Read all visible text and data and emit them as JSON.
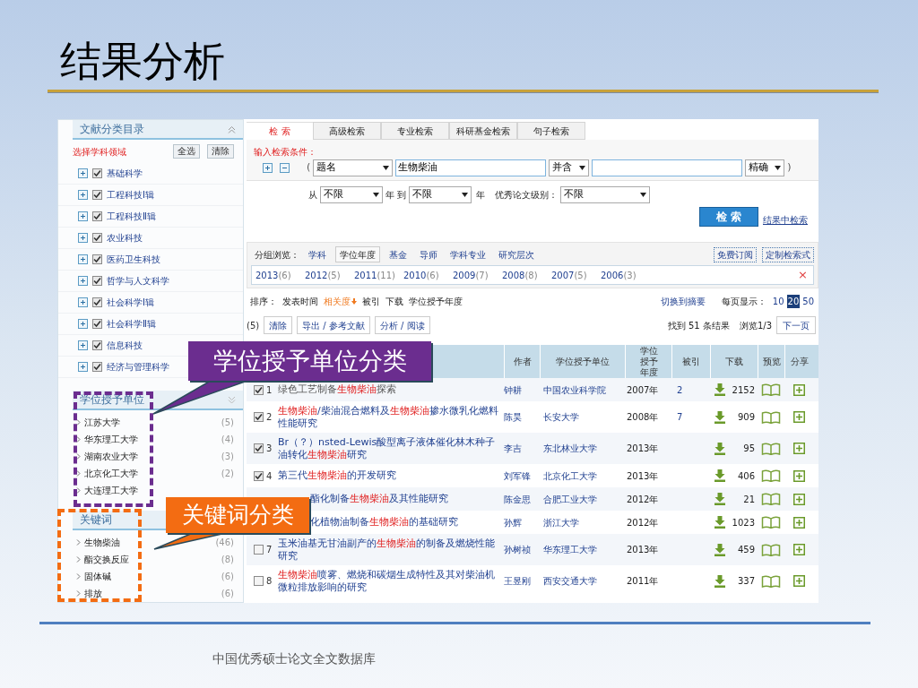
{
  "slide": {
    "title": "结果分析",
    "footer": "中国优秀硕士论文全文数据库"
  },
  "sidebar": {
    "heading": "文献分类目录",
    "field_label": "选择学科领域",
    "buttons": [
      "全选",
      "清除"
    ],
    "items": [
      {
        "label": "基础科学",
        "checked": true
      },
      {
        "label": "工程科技Ⅰ辑",
        "checked": true
      },
      {
        "label": "工程科技Ⅱ辑",
        "checked": true
      },
      {
        "label": "农业科技",
        "checked": true
      },
      {
        "label": "医药卫生科技",
        "checked": true
      },
      {
        "label": "哲学与人文科学",
        "checked": true
      },
      {
        "label": "社会科学Ⅰ辑",
        "checked": true
      },
      {
        "label": "社会科学Ⅱ辑",
        "checked": true
      },
      {
        "label": "信息科技",
        "checked": true
      },
      {
        "label": "经济与管理科学",
        "checked": true
      }
    ],
    "facets": [
      {
        "heading": "学位授予单位",
        "items": [
          {
            "label": "江苏大学",
            "count": "(5)"
          },
          {
            "label": "华东理工大学",
            "count": "(4)"
          },
          {
            "label": "湖南农业大学",
            "count": "(3)"
          },
          {
            "label": "北京化工大学",
            "count": "(2)"
          },
          {
            "label": "大连理工大学"
          }
        ]
      },
      {
        "heading": "关键词",
        "items": [
          {
            "label": "生物柴油",
            "count": "(46)"
          },
          {
            "label": "酯交换反应",
            "count": "(8)"
          },
          {
            "label": "固体碱",
            "count": "(6)"
          },
          {
            "label": "排放",
            "count": "(6)"
          }
        ]
      }
    ]
  },
  "search": {
    "tabs": [
      {
        "label": "检 索",
        "selected": true
      },
      {
        "label": "高级检索",
        "selected": false
      },
      {
        "label": "专业检索",
        "selected": false
      },
      {
        "label": "科研基金检索",
        "selected": false
      },
      {
        "label": "句子检索",
        "selected": false
      }
    ],
    "prompt": "输入检索条件：",
    "open_paren": "(",
    "field": "题名",
    "value": "生物柴油",
    "operator": "并含",
    "match": "精确",
    "close_paren": ")",
    "from_label": "从",
    "from": "不限",
    "to_label": "年 到",
    "to": "不限",
    "year_label": "年",
    "level_label": "优秀论文级别：",
    "level": "不限",
    "submit": "检 索",
    "refine_link": "结果中检索"
  },
  "grouping": {
    "label": "分组浏览：",
    "tabs": [
      {
        "label": "学科",
        "selected": false
      },
      {
        "label": "学位年度",
        "selected": true
      },
      {
        "label": "基金",
        "selected": false
      },
      {
        "label": "导师",
        "selected": false
      },
      {
        "label": "学科专业",
        "selected": false
      },
      {
        "label": "研究层次",
        "selected": false
      }
    ],
    "links": [
      "免费订阅",
      "定制检索式"
    ],
    "years": [
      {
        "year": "2013",
        "count": "(6)"
      },
      {
        "year": "2012",
        "count": "(5)"
      },
      {
        "year": "2011",
        "count": "(11)"
      },
      {
        "year": "2010",
        "count": "(6)"
      },
      {
        "year": "2009",
        "count": "(7)"
      },
      {
        "year": "2008",
        "count": "(8)"
      },
      {
        "year": "2007",
        "count": "(5)"
      },
      {
        "year": "2006",
        "count": "(3)"
      }
    ],
    "close": "×"
  },
  "sort": {
    "label": "排序：",
    "options": [
      {
        "label": "发表时间",
        "selected": false
      },
      {
        "label": "相关度",
        "selected": true
      },
      {
        "label": "被引",
        "selected": false
      },
      {
        "label": "下载",
        "selected": false
      },
      {
        "label": "学位授予年度",
        "selected": false
      }
    ],
    "abstract_link": "切换到摘要",
    "per_page_label": "每页显示：",
    "per_page": [
      {
        "label": "10",
        "selected": false
      },
      {
        "label": "20",
        "selected": true
      },
      {
        "label": "50",
        "selected": false
      }
    ]
  },
  "toolbar": {
    "selected_count": "(5)",
    "buttons": [
      "清除",
      "导出 / 参考文献",
      "分析 / 阅读"
    ],
    "found": "找到 51 条结果",
    "page": "浏览1/3",
    "next": "下一页"
  },
  "table": {
    "columns": [
      "作者",
      "学位授予单位",
      "学位授予年度",
      "被引",
      "下载",
      "预览",
      "分享"
    ],
    "rows": [
      {
        "covered": false,
        "checked": true,
        "number": "1",
        "visited": true,
        "title": [
          {
            "text": "绿色工艺制备",
            "highlight": false
          },
          {
            "text": "生物柴油",
            "highlight": true
          },
          {
            "text": "探索",
            "highlight": false
          }
        ],
        "author": "钟耕",
        "unit": "中国农业科学院",
        "year": "2007年",
        "cited": "2",
        "downloads": "2152"
      },
      {
        "covered": false,
        "checked": true,
        "number": "2",
        "visited": false,
        "title": [
          {
            "text": "生物柴油",
            "highlight": true
          },
          {
            "text": "/柴油混合燃料及",
            "highlight": false
          },
          {
            "text": "生物柴油",
            "highlight": true
          },
          {
            "text": "掺水微乳化燃料性能研究",
            "highlight": false
          }
        ],
        "author": "陈昊",
        "unit": "长安大学",
        "year": "2008年",
        "cited": "7",
        "downloads": "909"
      },
      {
        "covered": false,
        "checked": true,
        "number": "3",
        "visited": false,
        "title": [
          {
            "text": "Br（？）nsted-Lewis酸型离子液体催化林木种子油转化",
            "highlight": false
          },
          {
            "text": "生物柴油",
            "highlight": true
          },
          {
            "text": "研究",
            "highlight": false
          }
        ],
        "author": "李吉",
        "unit": "东北林业大学",
        "year": "2013年",
        "downloads": "95"
      },
      {
        "covered": false,
        "checked": true,
        "number": "4",
        "visited": false,
        "title": [
          {
            "text": "第三代",
            "highlight": false
          },
          {
            "text": "生物柴油",
            "highlight": true
          },
          {
            "text": "的开发研究",
            "highlight": false
          }
        ],
        "author": "刘军锋",
        "unit": "北京化工大学",
        "year": "2013年",
        "downloads": "406"
      },
      {
        "covered": true,
        "visited": false,
        "title": [
          {
            "text": "酯化制备",
            "highlight": false
          },
          {
            "text": "生物柴油",
            "highlight": true
          },
          {
            "text": "及其性能研究",
            "highlight": false
          }
        ],
        "author": "陈金思",
        "unit": "合肥工业大学",
        "year": "2012年",
        "downloads": "21"
      },
      {
        "covered": true,
        "visited": false,
        "title": [
          {
            "text": "化植物油制备",
            "highlight": false
          },
          {
            "text": "生物柴油",
            "highlight": true
          },
          {
            "text": "的基础研究",
            "highlight": false
          }
        ],
        "author": "孙辉",
        "unit": "浙江大学",
        "year": "2012年",
        "downloads": "1023"
      },
      {
        "covered": false,
        "checked": false,
        "number": "7",
        "visited": false,
        "title": [
          {
            "text": "玉米油基无甘油副产的",
            "highlight": false
          },
          {
            "text": "生物柴油",
            "highlight": true
          },
          {
            "text": "的制备及燃烧性能研究",
            "highlight": false
          }
        ],
        "author": "孙树祯",
        "unit": "华东理工大学",
        "year": "2013年",
        "downloads": "459"
      },
      {
        "covered": false,
        "checked": false,
        "number": "8",
        "visited": false,
        "title": [
          {
            "text": "生物柴油",
            "highlight": true
          },
          {
            "text": "喷雾、燃烧和碳烟生成特性及其对柴油机微粒排放影响的研究",
            "highlight": false
          }
        ],
        "author": "王昱刚",
        "unit": "西安交通大学",
        "year": "2011年",
        "downloads": "337"
      }
    ]
  },
  "callouts": [
    {
      "text": "学位授予单位分类",
      "color": "#6b2d8f"
    },
    {
      "text": "关键词分类",
      "color": "#f36c12"
    }
  ]
}
